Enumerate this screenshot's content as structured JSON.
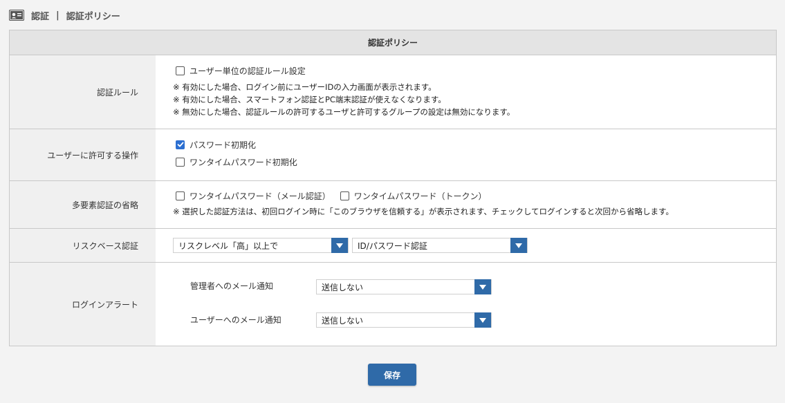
{
  "breadcrumb": {
    "icon": "id-card-icon",
    "section": "認証",
    "separator": "|",
    "current": "認証ポリシー"
  },
  "panel": {
    "title": "認証ポリシー",
    "auth_rule": {
      "label": "認証ルール",
      "checkbox_label": "ユーザー単位の認証ルール設定",
      "checked": false,
      "notes": [
        "※ 有効にした場合、ログイン前にユーザーIDの入力画面が表示されます。",
        "※ 有効にした場合、スマートフォン認証とPC端末認証が使えなくなります。",
        "※ 無効にした場合、認証ルールの許可するユーザと許可するグループの設定は無効になります。"
      ]
    },
    "user_ops": {
      "label": "ユーザーに許可する操作",
      "options": [
        {
          "label": "パスワード初期化",
          "checked": true
        },
        {
          "label": "ワンタイムパスワード初期化",
          "checked": false
        }
      ]
    },
    "mfa_skip": {
      "label": "多要素認証の省略",
      "options": [
        {
          "label": "ワンタイムパスワード（メール認証）",
          "checked": false
        },
        {
          "label": "ワンタイムパスワード（トークン）",
          "checked": false
        }
      ],
      "note": "※ 選択した認証方法は、初回ログイン時に「このブラウザを信頼する」が表示されます、チェックしてログインすると次回から省略します。"
    },
    "risk_based": {
      "label": "リスクベース認証",
      "level_select": "リスクレベル「高」以上で",
      "method_select": "ID/パスワード認証"
    },
    "login_alert": {
      "label": "ログインアラート",
      "admin_label": "管理者へのメール通知",
      "admin_select": "送信しない",
      "user_label": "ユーザーへのメール通知",
      "user_select": "送信しない"
    }
  },
  "save_button": "保存",
  "colors": {
    "accent": "#2f6aa8",
    "checkbox_checked": "#2c6fd1",
    "label_bg": "#f0f0f0",
    "header_bg": "#e4e4e4"
  }
}
